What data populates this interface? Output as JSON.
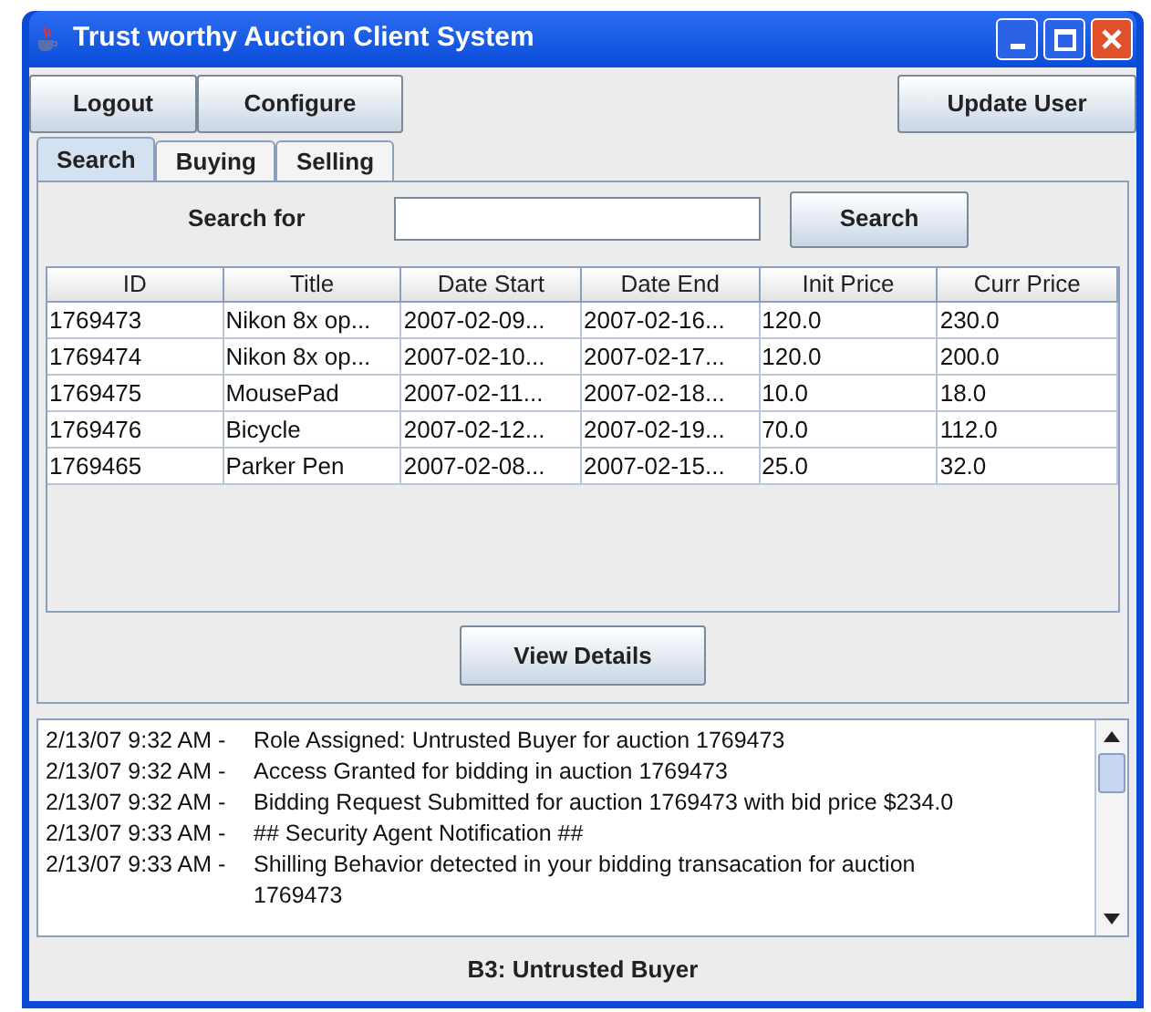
{
  "window": {
    "title": "Trust worthy Auction Client System"
  },
  "toolbar": {
    "left_buttons": [
      "Logout",
      "Configure"
    ],
    "right_button": "Update User"
  },
  "tabs": [
    {
      "label": "Search",
      "selected": true
    },
    {
      "label": "Buying",
      "selected": false
    },
    {
      "label": "Selling",
      "selected": false
    }
  ],
  "search": {
    "label": "Search for",
    "button": "Search"
  },
  "table": {
    "columns": [
      "ID",
      "Title",
      "Date Start",
      "Date End",
      "Init Price",
      "Curr Price"
    ],
    "rows": [
      [
        "1769473",
        "Nikon 8x op...",
        "2007-02-09...",
        "2007-02-16...",
        "120.0",
        "230.0"
      ],
      [
        "1769474",
        "Nikon 8x op...",
        "2007-02-10...",
        "2007-02-17...",
        "120.0",
        "200.0"
      ],
      [
        "1769475",
        "MousePad",
        "2007-02-11...",
        "2007-02-18...",
        "10.0",
        "18.0"
      ],
      [
        "1769476",
        "Bicycle",
        "2007-02-12...",
        "2007-02-19...",
        "70.0",
        "112.0"
      ],
      [
        "1769465",
        "Parker Pen",
        "2007-02-08...",
        "2007-02-15...",
        "25.0",
        "32.0"
      ]
    ]
  },
  "view_details_button": "View Details",
  "log": [
    {
      "time": "2/13/07 9:32 AM -",
      "text": "Role Assigned: Untrusted Buyer for auction 1769473"
    },
    {
      "time": "2/13/07 9:32 AM -",
      "text": "Access Granted for bidding in auction 1769473"
    },
    {
      "time": "2/13/07 9:32 AM -",
      "text": "Bidding Request Submitted for auction 1769473 with bid price $234.0"
    },
    {
      "time": "2/13/07 9:33 AM -",
      "text": "## Security Agent Notification ##"
    },
    {
      "time": "2/13/07 9:33 AM -",
      "text": "Shilling Behavior detected in your bidding transacation for auction 1769473"
    }
  ],
  "status_bar": "B3: Untrusted Buyer"
}
